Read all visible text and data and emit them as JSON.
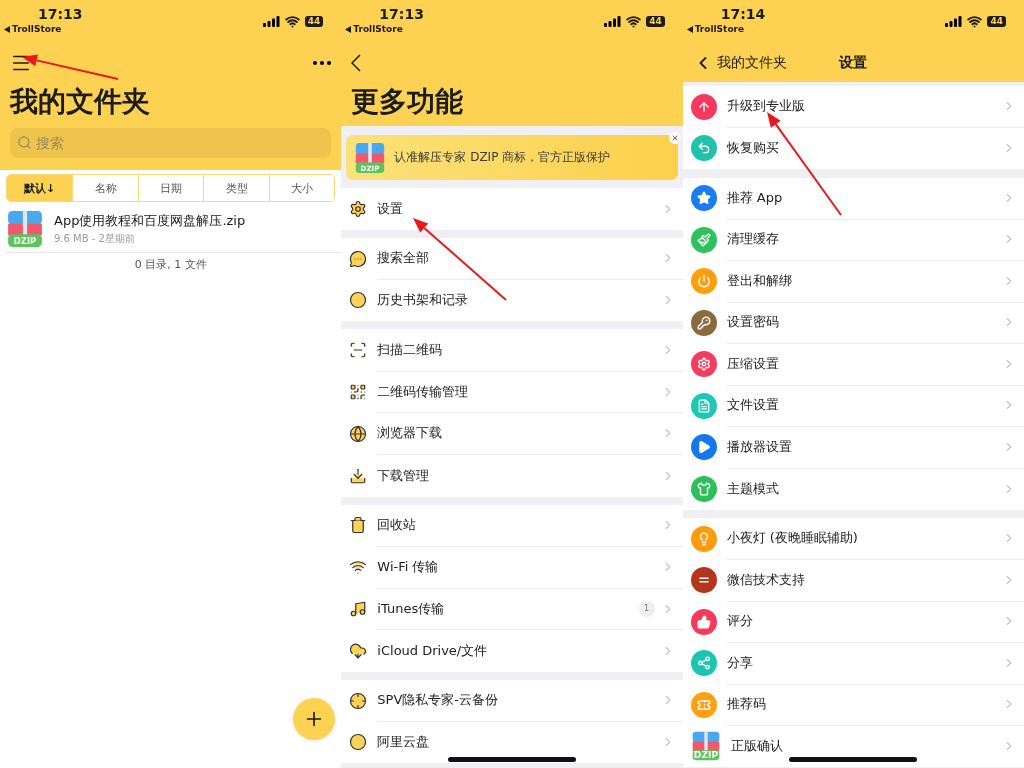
{
  "screens": [
    {
      "kind": "files",
      "status": {
        "time": "17:13",
        "back_app": "TrollStore",
        "battery": "44"
      },
      "title": "我的文件夹",
      "search": {
        "placeholder": "搜索"
      },
      "sort_tabs": [
        {
          "label": "默认↓",
          "selected": true
        },
        {
          "label": "名称",
          "selected": false
        },
        {
          "label": "日期",
          "selected": false
        },
        {
          "label": "类型",
          "selected": false
        },
        {
          "label": "大小",
          "selected": false
        }
      ],
      "files": [
        {
          "name": "App使用教程和百度网盘解压.zip",
          "meta": "9.6 MB - 2星期前",
          "logo_text": "DZIP"
        }
      ],
      "summary": "0 目录, 1 文件"
    },
    {
      "kind": "menu",
      "status": {
        "time": "17:13",
        "back_app": "TrollStore",
        "battery": "44"
      },
      "title": "更多功能",
      "banner": {
        "text": "认准解压专家 DZIP 商标，官方正版保护",
        "logo_text": "DZIP"
      },
      "groups": [
        {
          "items": [
            {
              "label": "设置"
            }
          ]
        },
        {
          "items": [
            {
              "label": "搜索全部"
            },
            {
              "label": "历史书架和记录"
            }
          ]
        },
        {
          "items": [
            {
              "label": "扫描二维码"
            },
            {
              "label": "二维码传输管理"
            },
            {
              "label": "浏览器下载"
            },
            {
              "label": "下载管理"
            }
          ]
        },
        {
          "items": [
            {
              "label": "回收站"
            },
            {
              "label": "Wi-Fi 传输"
            },
            {
              "label": "iTunes传输",
              "badge": "1"
            },
            {
              "label": "iCloud Drive/文件"
            }
          ]
        },
        {
          "items": [
            {
              "label": "SPV隐私专家-云备份"
            },
            {
              "label": "阿里云盘"
            }
          ]
        }
      ]
    },
    {
      "kind": "settings",
      "status": {
        "time": "17:14",
        "back_app": "TrollStore",
        "battery": "44"
      },
      "back_label": "我的文件夹",
      "title": "设置",
      "groups": [
        {
          "items": [
            {
              "kind": "circle",
              "label": "升级到专业版",
              "color": "#f5385e"
            },
            {
              "kind": "circle",
              "label": "恢复购买",
              "color": "#1dc3aa"
            }
          ]
        },
        {
          "items": [
            {
              "kind": "circle",
              "label": "推荐 App",
              "color": "#1a7cf5"
            },
            {
              "kind": "circle",
              "label": "清理缓存",
              "color": "#2fc25b"
            },
            {
              "kind": "circle",
              "label": "登出和解绑",
              "color": "#ff9f0a"
            },
            {
              "kind": "circle",
              "label": "设置密码",
              "color": "#8b6b3d"
            },
            {
              "kind": "circle",
              "label": "压缩设置",
              "color": "#f23d5f"
            },
            {
              "kind": "circle",
              "label": "文件设置",
              "color": "#1ec8b4"
            },
            {
              "kind": "circle",
              "label": "播放器设置",
              "color": "#1577f0"
            },
            {
              "kind": "circle",
              "label": "主题模式",
              "color": "#2dbf58"
            }
          ]
        },
        {
          "items": [
            {
              "kind": "circle",
              "label": "小夜灯 (夜晚睡眠辅助)",
              "color": "#ff9c0c"
            },
            {
              "kind": "circle",
              "label": "微信技术支持",
              "color": "#b3361c"
            },
            {
              "kind": "circle",
              "label": "评分",
              "color": "#f43a5c"
            },
            {
              "kind": "circle",
              "label": "分享",
              "color": "#1bc6b0"
            },
            {
              "kind": "circle",
              "label": "推荐码",
              "color": "#ffa010"
            },
            {
              "kind": "logo",
              "label": "正版确认",
              "logo_text": "DZIP"
            }
          ]
        }
      ]
    }
  ]
}
